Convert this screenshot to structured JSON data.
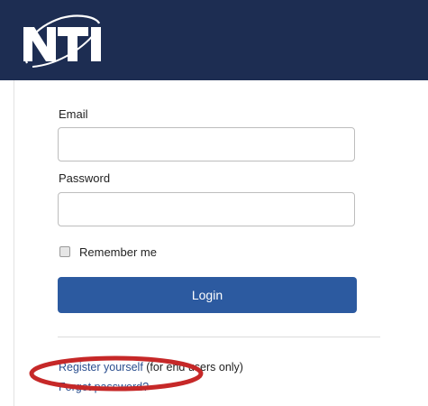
{
  "brand": {
    "logo_text": "NTI",
    "header_color": "#1d2d52"
  },
  "form": {
    "email_label": "Email",
    "email_value": "",
    "password_label": "Password",
    "password_value": "",
    "remember_label": "Remember me",
    "remember_checked": false,
    "login_label": "Login",
    "button_color": "#2c5aa0"
  },
  "links": {
    "register_link": "Register yourself",
    "register_note": " (for end users only)",
    "forgot_password": "Forgot password?"
  },
  "annotation": {
    "color": "#c62828"
  }
}
